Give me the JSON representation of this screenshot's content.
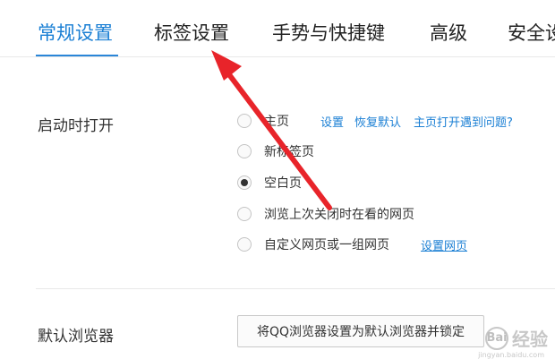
{
  "tabs": [
    {
      "label": "常规设置",
      "active": true
    },
    {
      "label": "标签设置",
      "active": false
    },
    {
      "label": "手势与快捷键",
      "active": false
    },
    {
      "label": "高级",
      "active": false
    },
    {
      "label": "安全设",
      "active": false
    }
  ],
  "startup": {
    "label": "启动时打开",
    "options": [
      {
        "label": "主页",
        "checked": false
      },
      {
        "label": "新标签页",
        "checked": false
      },
      {
        "label": "空白页",
        "checked": true
      },
      {
        "label": "浏览上次关闭时在看的网页",
        "checked": false
      },
      {
        "label": "自定义网页或一组网页",
        "checked": false
      }
    ],
    "homepage_links": {
      "settings": "设置",
      "restore_default": "恢复默认",
      "problem": "主页打开遇到问题?"
    },
    "custom_link": "设置网页"
  },
  "default_browser": {
    "label": "默认浏览器",
    "button": "将QQ浏览器设置为默认浏览器并锁定"
  },
  "annotation": {
    "color": "#e8242a"
  },
  "watermark": {
    "text": "经验",
    "logo": "Bai",
    "sub": "jingyan.baidu.com"
  },
  "colors": {
    "accent": "#1a7fd4",
    "text": "#333333"
  }
}
